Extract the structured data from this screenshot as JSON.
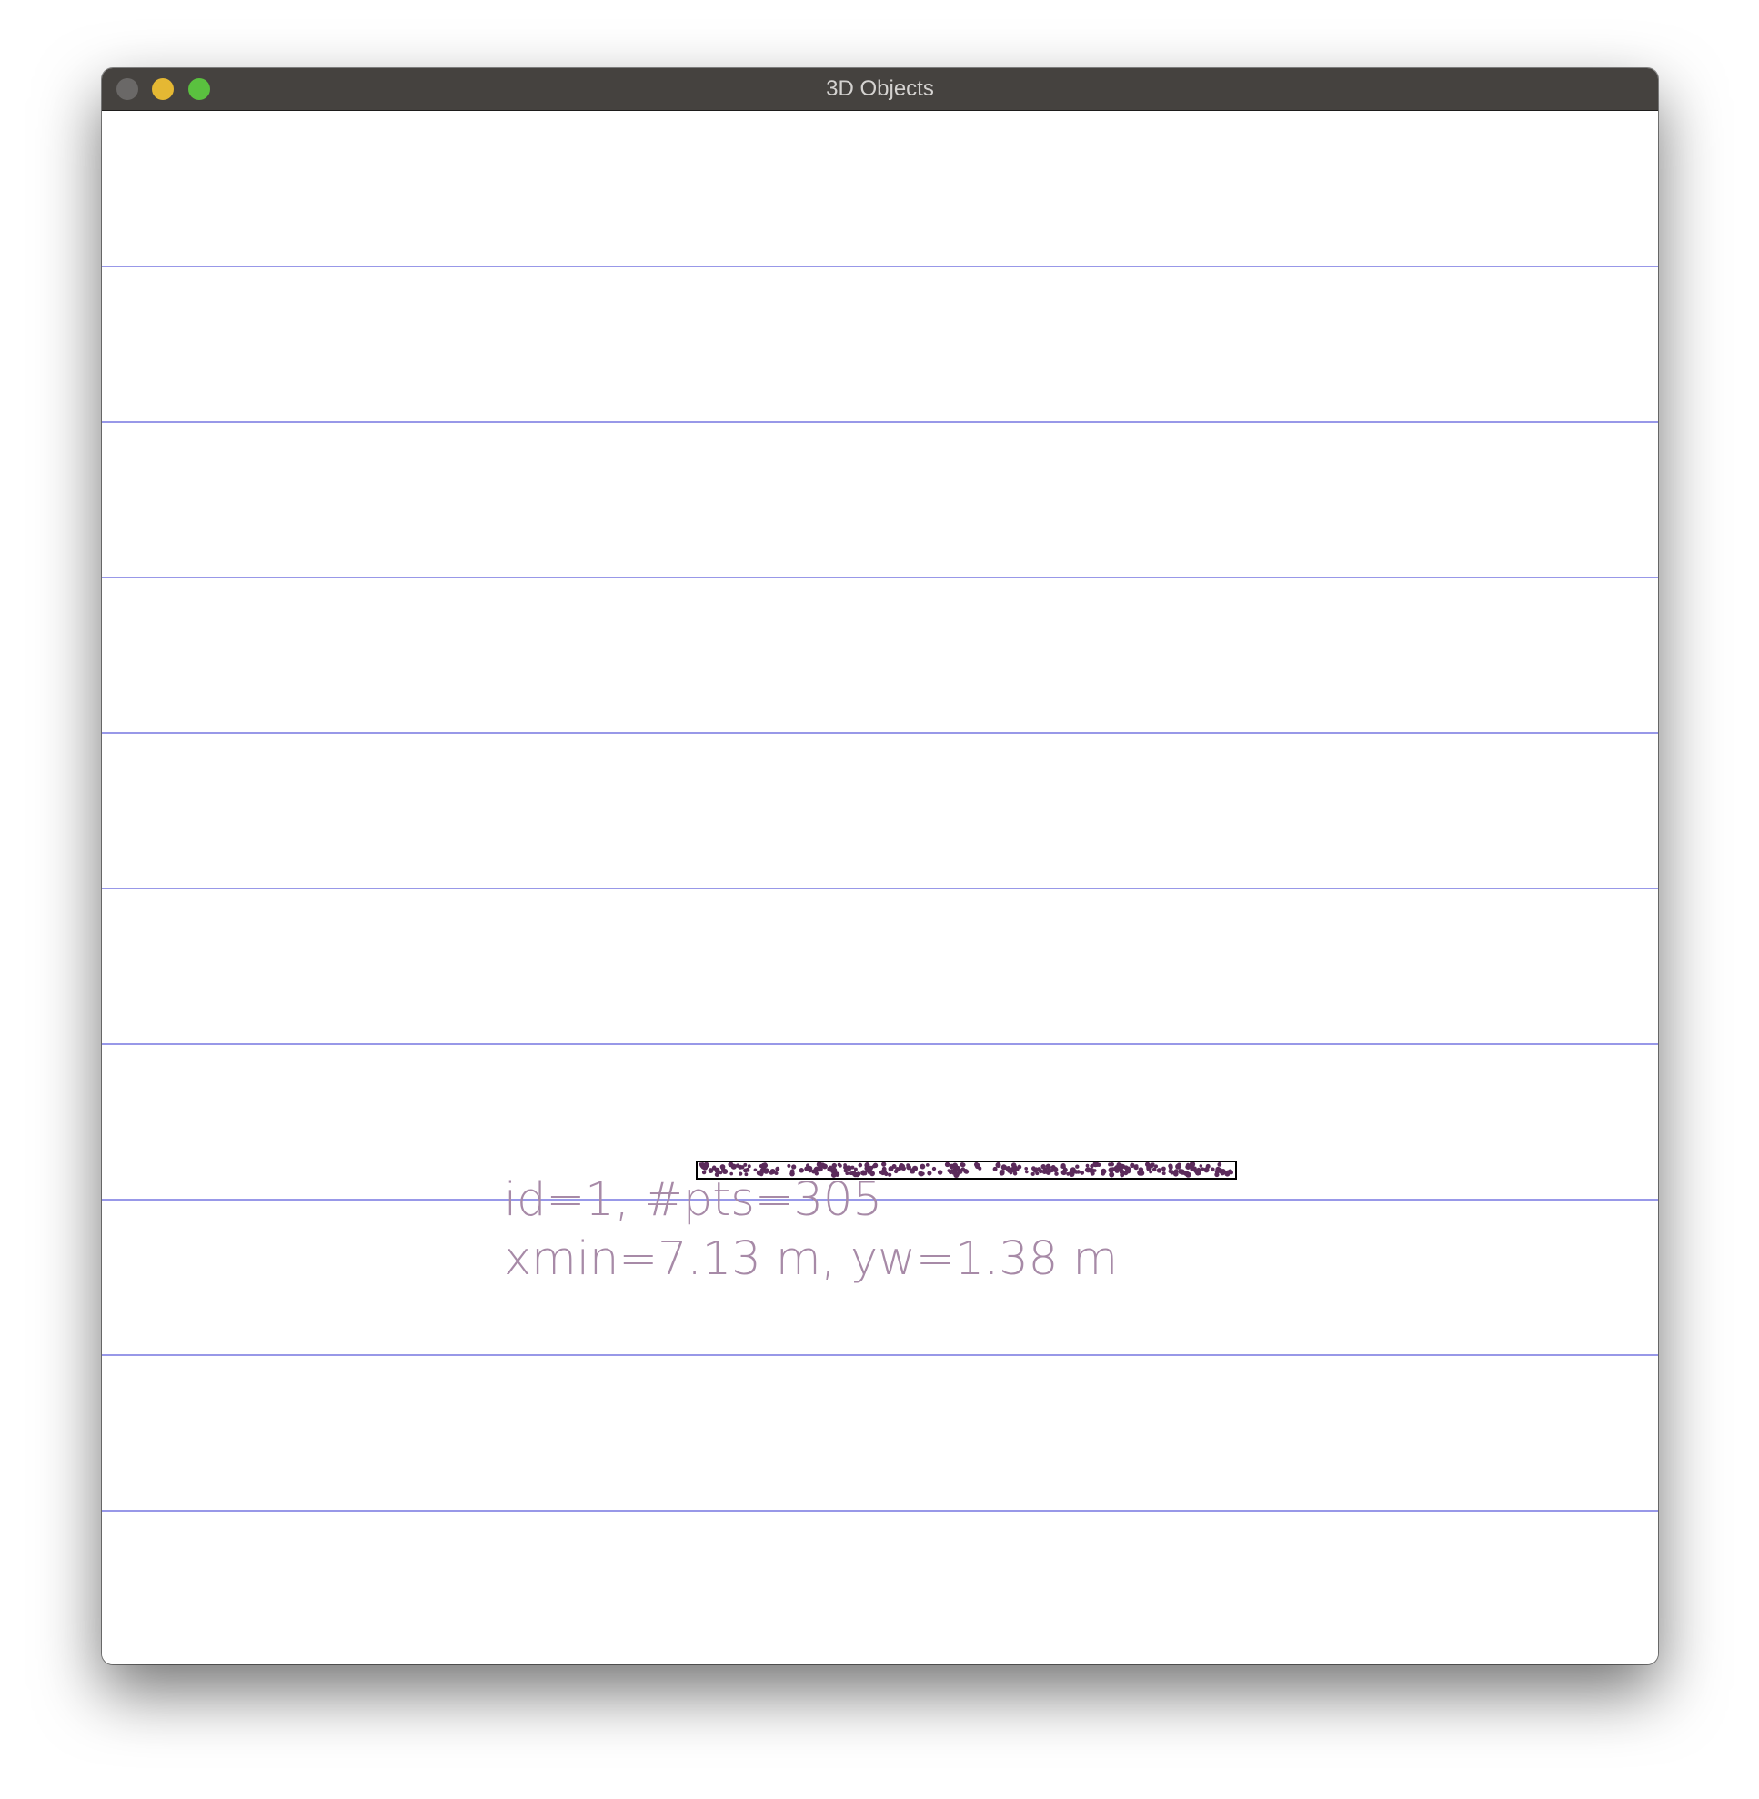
{
  "window": {
    "title": "3D Objects"
  },
  "colors": {
    "titlebar": "#45423f",
    "title_text": "#d4d2d0",
    "close": "#6a6867",
    "minimize": "#e5b833",
    "zoom": "#5ac13f",
    "grid_line": "#5b5bd9",
    "points": "#5b2b5b",
    "box": "#000000",
    "label_text": "#a78aa7"
  },
  "icons": {
    "close": "close-icon",
    "minimize": "minimize-icon",
    "zoom": "zoom-icon"
  },
  "viewer": {
    "grid_lines": 9,
    "object": {
      "point_count": 305,
      "label_line1": "id=1, #pts=305",
      "label_line2": "xmin=7.13 m, yw=1.38 m"
    }
  }
}
